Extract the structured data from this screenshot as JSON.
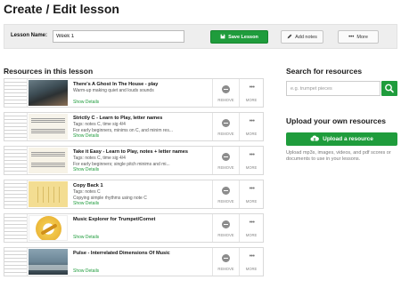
{
  "page": {
    "title": "Create / Edit lesson"
  },
  "lesson_bar": {
    "name_label": "Lesson Name:",
    "name_value": "Week 1",
    "save_label": "Save Lesson",
    "add_notes_label": "Add notes",
    "more_label": "More"
  },
  "resources": {
    "heading": "Resources in this lesson",
    "show_details": "Show Details",
    "remove_label": "REMOVE",
    "more_label": "MORE",
    "items": [
      {
        "title": "There's A Ghost In The House - play",
        "lines": [
          "Warm-up making quiet and louds sounds"
        ],
        "thumb": "ghost-thumbnail"
      },
      {
        "title": "Strictly C - Learn to Play, letter names",
        "lines": [
          "Tags: notes C, time sig 4/4",
          "For early beginners, minims on C, and minim res..."
        ],
        "thumb": "sheet-music-thumbnail"
      },
      {
        "title": "Take it Easy - Learn to Play, notes + letter names",
        "lines": [
          "Tags: notes C, time sig 4/4",
          "For early beginners; single pitch minims and mi..."
        ],
        "thumb": "sheet-music-thumbnail"
      },
      {
        "title": "Copy Back 1",
        "lines": [
          "Tags: notes C",
          "Copying simple rhythms using note C"
        ],
        "thumb": "rhythm-grid-thumbnail"
      },
      {
        "title": "Music Explorer for Trumpet/Cornet",
        "lines": [],
        "thumb": "trumpet-thumbnail"
      },
      {
        "title": "Pulse - Interrelated Dimensions Of Music",
        "lines": [],
        "thumb": "landscape-thumbnail"
      }
    ]
  },
  "search": {
    "heading": "Search for resources",
    "placeholder": "e.g. trumpet pieces",
    "icon": "search-icon"
  },
  "upload": {
    "heading": "Upload your own resources",
    "button_label": "Upload a resource",
    "description": "Upload mp3s, images, videos, and pdf scores or documents to use in your lessons."
  },
  "colors": {
    "accent": "#1f9c3c",
    "bar_background": "#eeeeee",
    "muted_text": "#777777"
  }
}
